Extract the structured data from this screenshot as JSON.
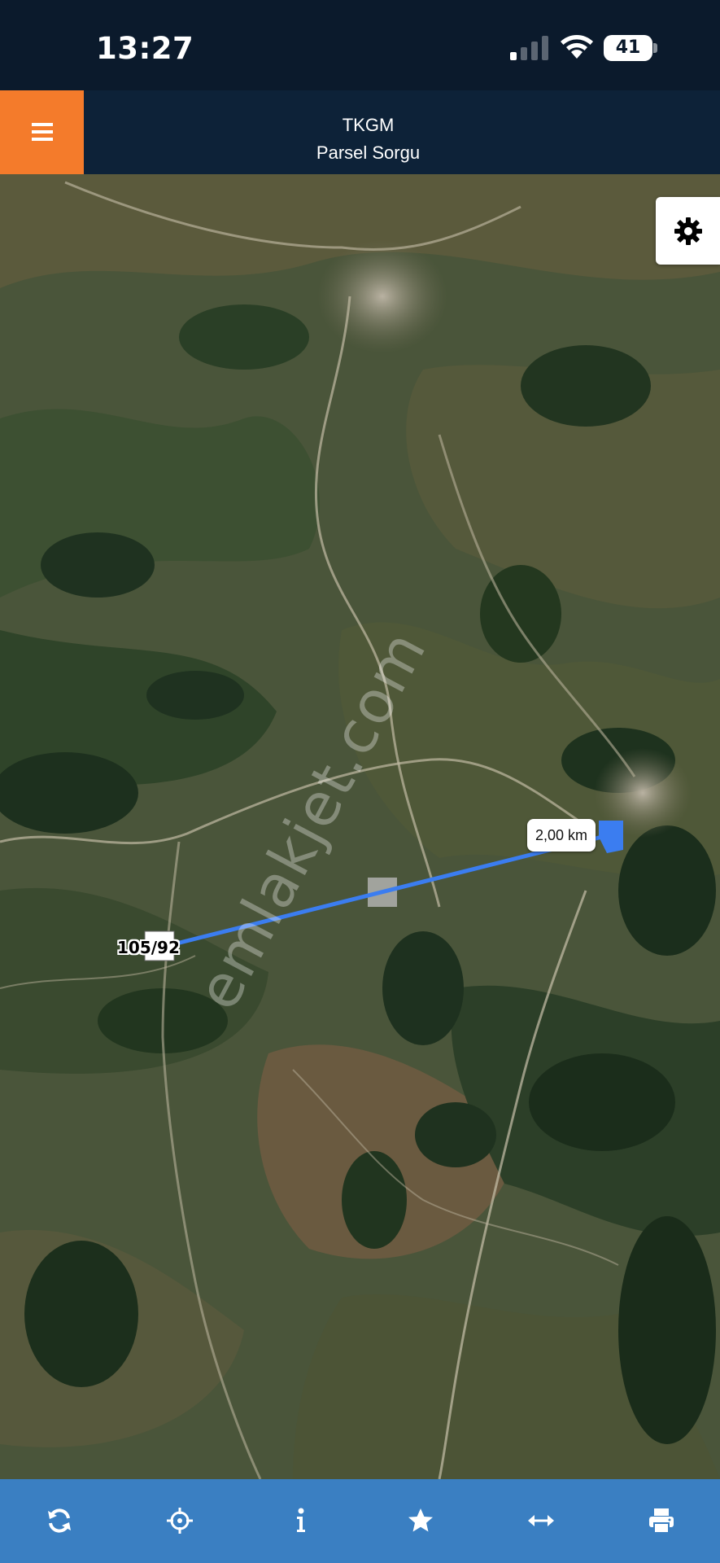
{
  "status_bar": {
    "time": "13:27",
    "battery_level": "41",
    "signal_icon": "cellular-signal-icon",
    "wifi_icon": "wifi-icon",
    "battery_icon": "battery-icon"
  },
  "header": {
    "title": "TKGM",
    "subtitle": "Parsel Sorgu",
    "menu_icon": "hamburger-menu-icon",
    "accent_color": "#f47b2b",
    "background_color": "#0d2238"
  },
  "map": {
    "type": "satellite",
    "settings_icon": "gear-icon",
    "measurement": {
      "distance_label": "2,00 km",
      "line_color": "#3b7df0"
    },
    "parcel_label": "105/92",
    "watermark": "emlakjet.com"
  },
  "toolbar": {
    "background_color": "#3a7fc2",
    "items": [
      {
        "icon": "refresh-icon"
      },
      {
        "icon": "locate-crosshair-icon"
      },
      {
        "icon": "info-icon"
      },
      {
        "icon": "star-icon"
      },
      {
        "icon": "measure-arrows-icon"
      },
      {
        "icon": "print-icon"
      }
    ]
  }
}
